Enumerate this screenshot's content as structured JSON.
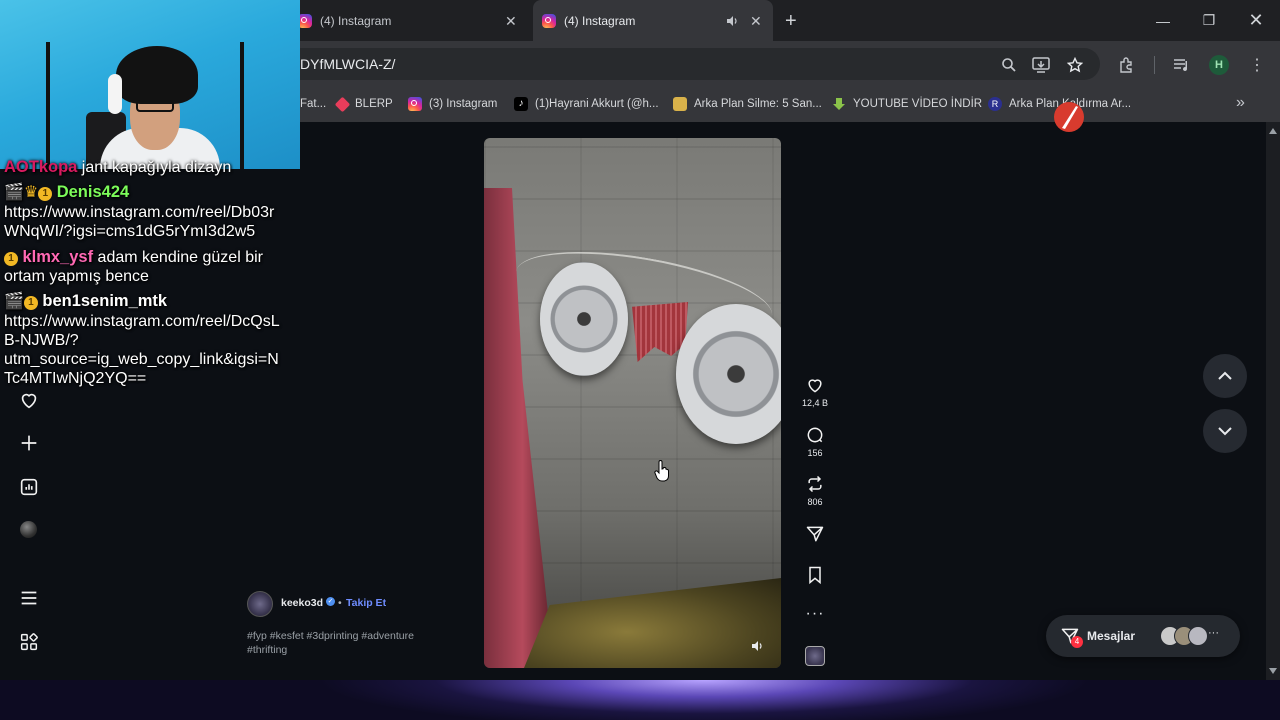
{
  "browser": {
    "tabs": [
      {
        "title": "(4) Instagram",
        "active": false
      },
      {
        "title": "(4) Instagram",
        "active": true
      }
    ],
    "url": "DYfMLWCIA-Z/",
    "profile_initial": "H",
    "bookmarks": [
      {
        "label": "Fat...",
        "icon": "bookmark-icon"
      },
      {
        "label": "BLERP",
        "icon": "blerp-icon"
      },
      {
        "label": "(3) Instagram",
        "icon": "instagram-icon"
      },
      {
        "label": "(1)Hayrani Akkurt (@h...",
        "icon": "tiktok-icon"
      },
      {
        "label": "Arka Plan Silme: 5 San...",
        "icon": "image-icon"
      },
      {
        "label": "YOUTUBE VİDEO İNDİR",
        "icon": "download-icon"
      },
      {
        "label": "Arka Plan Kaldırma Ar...",
        "icon": "remove-bg-icon"
      }
    ]
  },
  "chat": {
    "lines": [
      {
        "name": "AOTkopa",
        "text": "jant kapağıyla dizayn"
      },
      {
        "name": "Denis424",
        "text": ""
      },
      {
        "name": "",
        "text": "https://www.instagram.com/reel/Db03r"
      },
      {
        "name": "",
        "text": "WNqWI/?igsi=cms1dG5rYmI3d2w5"
      },
      {
        "name": "klmx_ysf",
        "text": "adam kendine güzel bir"
      },
      {
        "name": "",
        "text": "ortam yapmış bence"
      },
      {
        "name": "ben1senim_mtk",
        "text": ""
      },
      {
        "name": "",
        "text": "https://www.instagram.com/reel/DcQsL"
      },
      {
        "name": "",
        "text": "B-NJWB/?"
      },
      {
        "name": "",
        "text": "utm_source=ig_web_copy_link&igsi=N"
      },
      {
        "name": "",
        "text": "Tc4MTIwNjQ2YQ=="
      }
    ],
    "badge_value": "1",
    "colors": {
      "AOTkopa": "#d81b60",
      "Denis424": "#7cfc5a",
      "klmx_ysf": "#ff69b4",
      "ben1senim_mtk": "#ffffff"
    }
  },
  "post": {
    "author": "keeko3d",
    "follow_label": "Takip Et",
    "separator": "•",
    "caption_line1": "#fyp #kesfet #3dprinting #adventure",
    "caption_line2": "#thrifting",
    "likes": "12,4 B",
    "comments": "156",
    "reposts": "806"
  },
  "messages": {
    "label": "Mesajlar",
    "unread": "4"
  },
  "colors": {
    "instagram_bg": "#0c0f14",
    "chrome_toolbar": "#35363a",
    "follow_blue": "#6f8dff"
  }
}
